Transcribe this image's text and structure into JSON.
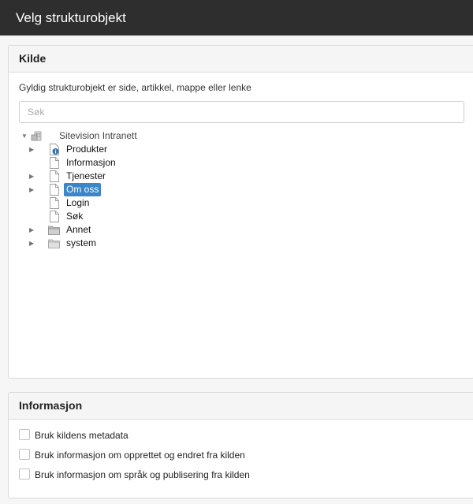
{
  "dialog": {
    "title": "Velg strukturobjekt"
  },
  "kilde": {
    "header": "Kilde",
    "description": "Gyldig strukturobjekt er side, artikkel, mappe eller lenke",
    "search_placeholder": "Søk",
    "tree": {
      "root": "Sitevision Intranett",
      "items": [
        {
          "label": "Produkter",
          "icon": "page-info-icon",
          "expandable": true
        },
        {
          "label": "Informasjon",
          "icon": "page-icon",
          "expandable": false
        },
        {
          "label": "Tjenester",
          "icon": "page-icon",
          "expandable": true
        },
        {
          "label": "Om oss",
          "icon": "page-icon",
          "expandable": true,
          "selected": true
        },
        {
          "label": "Login",
          "icon": "page-icon",
          "expandable": false
        },
        {
          "label": "Søk",
          "icon": "page-icon",
          "expandable": false
        },
        {
          "label": "Annet",
          "icon": "folder-icon",
          "expandable": true
        },
        {
          "label": "system",
          "icon": "folder-icon",
          "expandable": true
        }
      ]
    }
  },
  "informasjon": {
    "header": "Informasjon",
    "options": [
      {
        "label": "Bruk kildens metadata",
        "checked": false
      },
      {
        "label": "Bruk informasjon om opprettet og endret fra kilden",
        "checked": false
      },
      {
        "label": "Bruk informasjon om språk og publisering fra kilden",
        "checked": false
      }
    ]
  },
  "colors": {
    "titlebar": "#2e2e2e",
    "selection": "#3a86c8"
  }
}
